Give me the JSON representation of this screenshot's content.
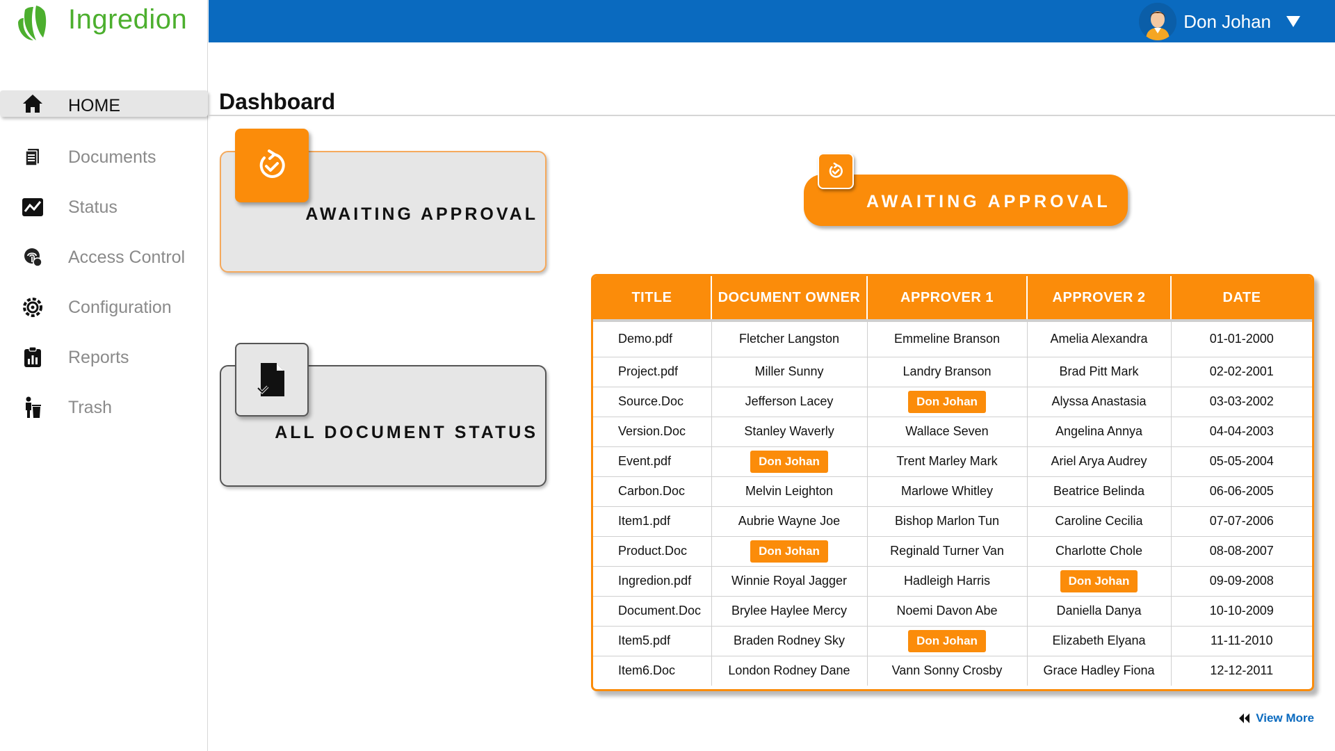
{
  "brand": {
    "name": "Ingredion"
  },
  "user": {
    "name": "Don Johan"
  },
  "sidebar": {
    "items": [
      {
        "label": "HOME",
        "icon": "home-icon",
        "active": true
      },
      {
        "label": "Documents",
        "icon": "document-icon"
      },
      {
        "label": "Status",
        "icon": "status-chart-icon"
      },
      {
        "label": "Access Control",
        "icon": "fingerprint-icon"
      },
      {
        "label": "Configuration",
        "icon": "gear-icon"
      },
      {
        "label": "Reports",
        "icon": "clipboard-report-icon"
      },
      {
        "label": "Trash",
        "icon": "trash-person-icon"
      }
    ]
  },
  "page": {
    "title": "Dashboard"
  },
  "cards": {
    "awaiting": {
      "label": "AWAITING APPROVAL",
      "icon": "refresh-check-icon"
    },
    "all_status": {
      "label": "ALL DOCUMENT STATUS",
      "icon": "file-check-icon"
    }
  },
  "section": {
    "label": "AWAITING APPROVAL",
    "icon": "refresh-check-icon"
  },
  "table": {
    "headers": [
      "TITLE",
      "DOCUMENT OWNER",
      "APPROVER 1",
      "APPROVER 2",
      "DATE"
    ],
    "rows": [
      [
        "Demo.pdf",
        "Fletcher Langston",
        "Emmeline Branson",
        "Amelia Alexandra",
        "01-01-2000"
      ],
      [
        "Project.pdf",
        "Miller Sunny",
        "Landry Branson",
        "Brad Pitt Mark",
        "02-02-2001"
      ],
      [
        "Source.Doc",
        "Jefferson Lacey",
        "Don Johan",
        "Alyssa Anastasia",
        "03-03-2002"
      ],
      [
        "Version.Doc",
        "Stanley Waverly",
        "Wallace Seven",
        "Angelina Annya",
        "04-04-2003"
      ],
      [
        "Event.pdf",
        "Don Johan",
        "Trent Marley Mark",
        "Ariel Arya Audrey",
        "05-05-2004"
      ],
      [
        "Carbon.Doc",
        "Melvin Leighton",
        "Marlowe Whitley",
        "Beatrice Belinda",
        "06-06-2005"
      ],
      [
        "Item1.pdf",
        "Aubrie Wayne Joe",
        "Bishop Marlon Tun",
        "Caroline Cecilia",
        "07-07-2006"
      ],
      [
        "Product.Doc",
        "Don Johan",
        "Reginald Turner Van",
        "Charlotte Chole",
        "08-08-2007"
      ],
      [
        "Ingredion.pdf",
        "Winnie Royal Jagger",
        "Hadleigh Harris",
        "Don Johan",
        "09-09-2008"
      ],
      [
        "Document.Doc",
        "Brylee Haylee Mercy",
        "Noemi Davon Abe",
        "Daniella Danya",
        "10-10-2009"
      ],
      [
        "Item5.pdf",
        "Braden Rodney Sky",
        "Don Johan",
        "Elizabeth Elyana",
        "11-11-2010"
      ],
      [
        "Item6.Doc",
        "London Rodney Dane",
        "Vann Sonny Crosby",
        "Grace Hadley Fiona",
        "12-12-2011"
      ]
    ],
    "highlight_name": "Don Johan"
  },
  "view_more": {
    "label": "View More",
    "icon": "double-chevron-left-icon"
  },
  "colors": {
    "accent": "#fb8c0a",
    "topbar": "#0a6abf",
    "brand_green": "#4caf2e"
  }
}
